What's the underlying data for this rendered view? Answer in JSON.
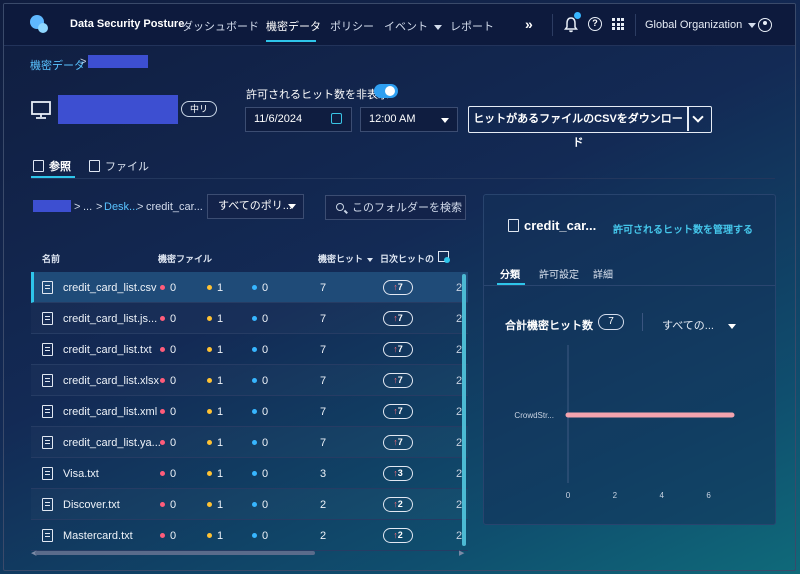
{
  "app": {
    "title": "Data Security Posture"
  },
  "nav": {
    "items": [
      {
        "label": "ダッシュボード",
        "active": false
      },
      {
        "label": "機密データ",
        "active": true
      },
      {
        "label": "ポリシー",
        "active": false
      },
      {
        "label": "イベント",
        "active": false,
        "dropdown": true
      },
      {
        "label": "レポート",
        "active": false
      }
    ],
    "more": "»",
    "org": "Global Organization"
  },
  "breadcrumb": {
    "root": "機密データ",
    "sep": ">"
  },
  "header": {
    "tag": "中リ",
    "toggle_label": "許可されるヒット数を非表示",
    "toggle_on": true,
    "date": "11/6/2024",
    "time": "12:00 AM",
    "csv_button": "ヒットがあるファイルのCSVをダウンロード"
  },
  "tabs": [
    {
      "label": "参照",
      "active": true
    },
    {
      "label": "ファイル",
      "active": false
    }
  ],
  "folder": {
    "sep": ">",
    "ellipsis": "...",
    "desk": "Desk...",
    "current": "credit_car..."
  },
  "filters": {
    "policy": "すべてのポリ...",
    "search_placeholder": "このフォルダーを検索"
  },
  "table": {
    "headers": {
      "name": "名前",
      "sensitive": "機密ファイル",
      "hits": "機密ヒット",
      "daily": "日次ヒットの"
    },
    "colors": {
      "red": "#ff5c7a",
      "yellow": "#ffc233",
      "blue": "#37b6ff"
    },
    "rows": [
      {
        "name": "credit_card_list.csv",
        "red": "0",
        "yellow": "1",
        "blue": "0",
        "hits": "7",
        "daily": "7",
        "selected": true
      },
      {
        "name": "credit_card_list.js...",
        "red": "0",
        "yellow": "1",
        "blue": "0",
        "hits": "7",
        "daily": "7"
      },
      {
        "name": "credit_card_list.txt",
        "red": "0",
        "yellow": "1",
        "blue": "0",
        "hits": "7",
        "daily": "7"
      },
      {
        "name": "credit_card_list.xlsx",
        "red": "0",
        "yellow": "1",
        "blue": "0",
        "hits": "7",
        "daily": "7"
      },
      {
        "name": "credit_card_list.xml",
        "red": "0",
        "yellow": "1",
        "blue": "0",
        "hits": "7",
        "daily": "7"
      },
      {
        "name": "credit_card_list.ya...",
        "red": "0",
        "yellow": "1",
        "blue": "0",
        "hits": "7",
        "daily": "7"
      },
      {
        "name": "Visa.txt",
        "red": "0",
        "yellow": "1",
        "blue": "0",
        "hits": "3",
        "daily": "3"
      },
      {
        "name": "Discover.txt",
        "red": "0",
        "yellow": "1",
        "blue": "0",
        "hits": "2",
        "daily": "2"
      },
      {
        "name": "Mastercard.txt",
        "red": "0",
        "yellow": "1",
        "blue": "0",
        "hits": "2",
        "daily": "2"
      }
    ],
    "daily_arrow": "↑",
    "cut": "2"
  },
  "panel": {
    "title": "credit_car...",
    "manage_link": "許可されるヒット数を管理する",
    "tabs": [
      {
        "label": "分類",
        "active": true
      },
      {
        "label": "許可設定",
        "active": false
      },
      {
        "label": "詳細",
        "active": false
      }
    ],
    "section_title": "合計機密ヒット数",
    "count": "7",
    "dropdown": "すべての..."
  },
  "chart_data": {
    "type": "bar",
    "orientation": "horizontal",
    "categories": [
      "CrowdStr..."
    ],
    "values": [
      7
    ],
    "xticks": [
      "0",
      "2",
      "4",
      "6"
    ],
    "xlim": [
      0,
      7
    ],
    "color": "#f4a3ae",
    "grid": false
  }
}
